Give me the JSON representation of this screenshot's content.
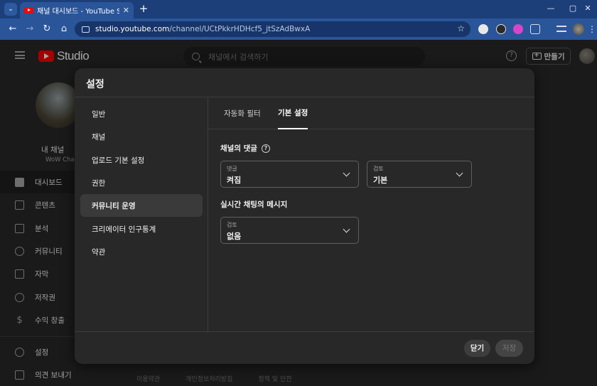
{
  "browser": {
    "tab_title": "채널 대시보드 - YouTube Studio",
    "url_host": "studio.youtube.com",
    "url_path": "/channel/UCtPkkrHDHcf5_jtSzAdBwxA"
  },
  "header": {
    "logo_text": "Studio",
    "search_placeholder": "채널에서 검색하기",
    "create_label": "만들기"
  },
  "sidebar": {
    "channel_name": "내 채널",
    "channel_handle": "WoW Chan",
    "items": [
      {
        "label": "대시보드",
        "icon": "dashboard-icon"
      },
      {
        "label": "콘텐츠",
        "icon": "content-icon"
      },
      {
        "label": "분석",
        "icon": "analytics-icon"
      },
      {
        "label": "커뮤니티",
        "icon": "community-icon"
      },
      {
        "label": "자막",
        "icon": "subtitles-icon"
      },
      {
        "label": "저작권",
        "icon": "copyright-icon"
      },
      {
        "label": "수익 창출",
        "icon": "monetization-icon"
      },
      {
        "label": "설정",
        "icon": "settings-icon"
      },
      {
        "label": "의견 보내기",
        "icon": "feedback-icon"
      }
    ]
  },
  "footer": {
    "links": [
      "이용약관",
      "개인정보처리방침",
      "정책 및 안전"
    ]
  },
  "modal": {
    "title": "설정",
    "nav": [
      "일반",
      "채널",
      "업로드 기본 설정",
      "권한",
      "커뮤니티 운영",
      "크리에이터 인구통계",
      "약관"
    ],
    "active_nav": "커뮤니티 운영",
    "tabs": [
      "자동화 필터",
      "기본 설정"
    ],
    "active_tab": "기본 설정",
    "comments_section": {
      "title": "채널의 댓글",
      "select1": {
        "caption": "댓글",
        "value": "켜짐"
      },
      "select2": {
        "caption": "검토",
        "value": "기본"
      }
    },
    "livechat_section": {
      "title": "실시간 채팅의 메시지",
      "select": {
        "caption": "검토",
        "value": "없음"
      }
    },
    "buttons": {
      "close": "닫기",
      "save": "저장"
    }
  }
}
